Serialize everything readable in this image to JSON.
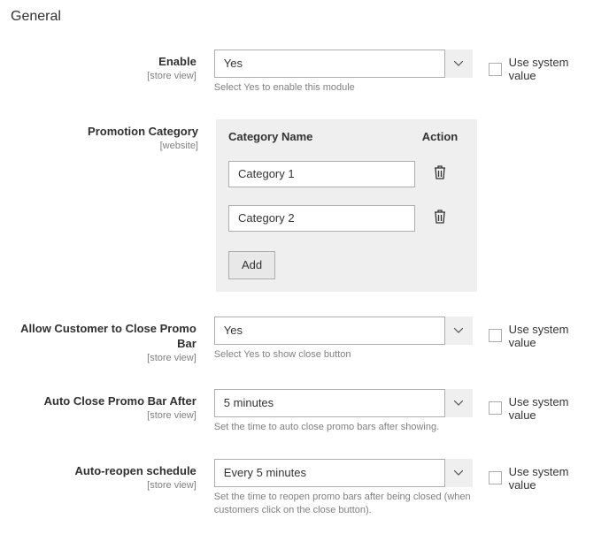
{
  "section_title": "General",
  "use_system_value_label": "Use system value",
  "category_table": {
    "header_name": "Category Name",
    "header_action": "Action",
    "add_button": "Add"
  },
  "fields": {
    "enable": {
      "label": "Enable",
      "scope": "[store view]",
      "value": "Yes",
      "hint": "Select Yes to enable this module"
    },
    "promotion_category": {
      "label": "Promotion Category",
      "scope": "[website]",
      "rows": [
        {
          "value": "Category 1"
        },
        {
          "value": "Category 2"
        }
      ]
    },
    "allow_close": {
      "label": "Allow Customer to Close Promo Bar",
      "scope": "[store view]",
      "value": "Yes",
      "hint": "Select Yes to show close button"
    },
    "auto_close": {
      "label": "Auto Close Promo Bar After",
      "scope": "[store view]",
      "value": "5 minutes",
      "hint": "Set the time to auto close promo bars after showing."
    },
    "auto_reopen": {
      "label": "Auto-reopen schedule",
      "scope": "[store view]",
      "value": "Every 5 minutes",
      "hint": "Set the time to reopen promo bars after being closed (when customers click on the close button)."
    }
  }
}
